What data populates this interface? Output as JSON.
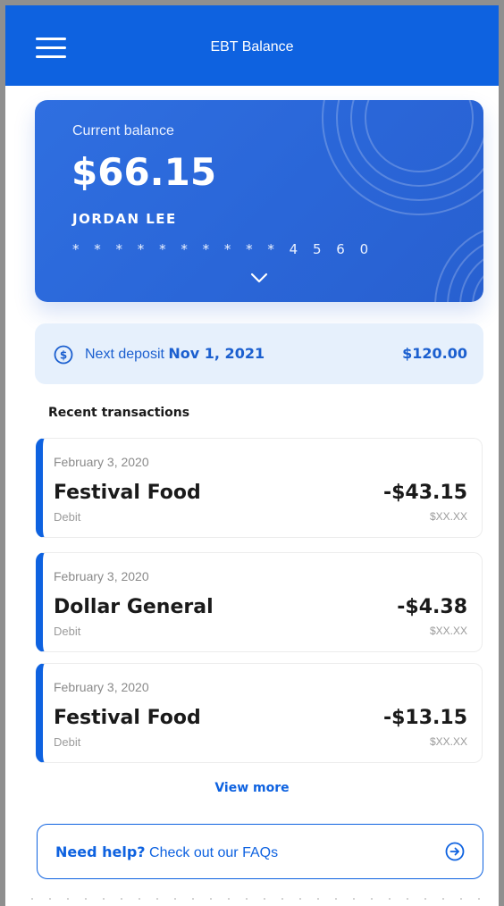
{
  "header": {
    "title": "EBT Balance",
    "menu_icon": "hamburger-menu-icon",
    "color": "#0e62e0"
  },
  "balance_card": {
    "label": "Current balance",
    "amount": "$66.15",
    "name": "JORDAN LEE",
    "card_number": "* * * * * * * * * * 4 5 6 0",
    "expand_icon": "chevron-down-icon"
  },
  "deposit": {
    "icon": "dollar-circle-icon",
    "label": "Next deposit",
    "date": "Nov 1, 2021",
    "amount": "$120.00"
  },
  "transactions": {
    "title": "Recent transactions",
    "items": [
      {
        "date": "February 3, 2020",
        "merchant": "Festival Food",
        "type": "Debit",
        "amount": "-$43.15",
        "sub_amount": "$XX.XX"
      },
      {
        "date": "February 3, 2020",
        "merchant": "Dollar General",
        "type": "Debit",
        "amount": "-$4.38",
        "sub_amount": "$XX.XX"
      },
      {
        "date": "February 3, 2020",
        "merchant": "Festival Food",
        "type": "Debit",
        "amount": "-$13.15",
        "sub_amount": "$XX.XX"
      }
    ],
    "view_more": "View more"
  },
  "help": {
    "strong": "Need help?",
    "text": " Check out our FAQs",
    "icon": "arrow-right-circle-icon"
  }
}
